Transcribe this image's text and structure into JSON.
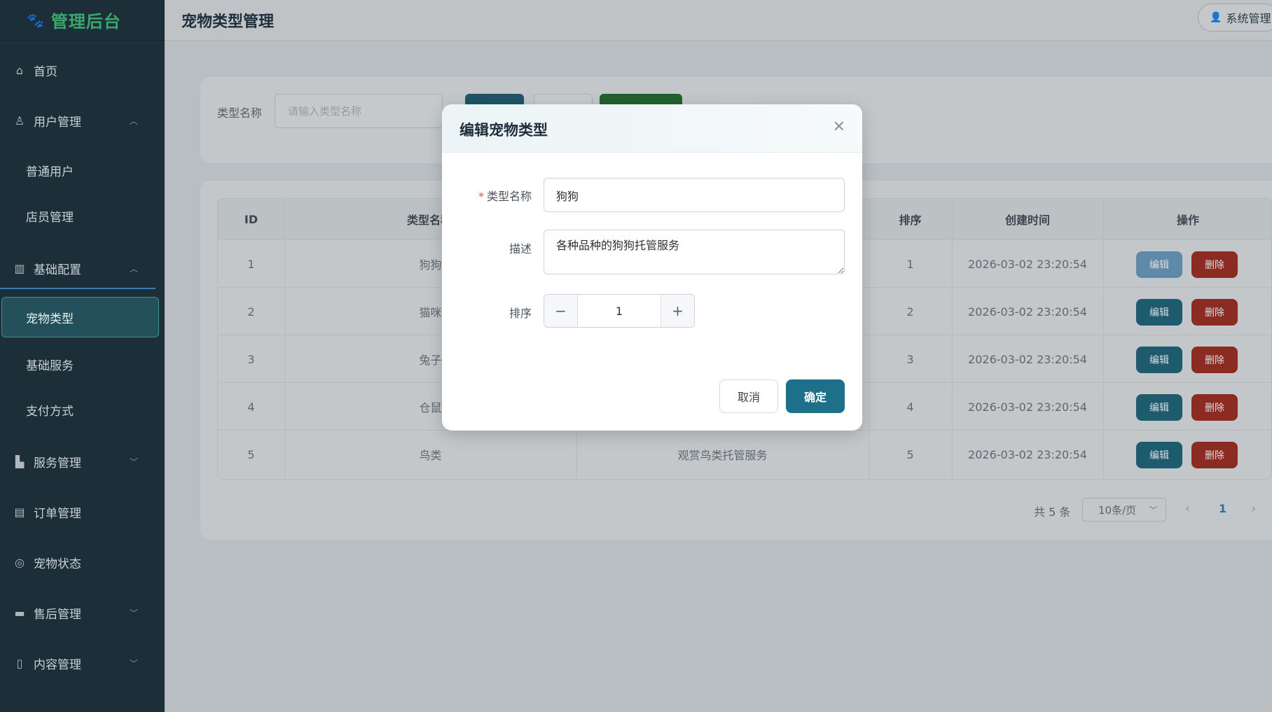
{
  "app": {
    "logo_text": "管理后台"
  },
  "header": {
    "page_title": "宠物类型管理",
    "user_label": "系统管理员"
  },
  "sidebar": {
    "home": "首页",
    "user_mgmt": "用户管理",
    "normal_users": "普通用户",
    "staff_mgmt": "店员管理",
    "base_config": "基础配置",
    "pet_types": "宠物类型",
    "base_services": "基础服务",
    "payment_methods": "支付方式",
    "service_mgmt": "服务管理",
    "order_mgmt": "订单管理",
    "pet_status": "宠物状态",
    "after_sales": "售后管理",
    "content_mgmt": "内容管理"
  },
  "search": {
    "label": "类型名称",
    "placeholder": "请输入类型名称"
  },
  "table": {
    "headers": {
      "id": "ID",
      "name": "类型名称",
      "sort": "排序",
      "created": "创建时间",
      "actions": "操作"
    },
    "edit_label": "编辑",
    "delete_label": "删除",
    "rows": [
      {
        "id": "1",
        "name": "狗狗",
        "desc": "",
        "sort": "1",
        "created": "2026-03-02 23:20:54"
      },
      {
        "id": "2",
        "name": "猫咪",
        "desc": "",
        "sort": "2",
        "created": "2026-03-02 23:20:54"
      },
      {
        "id": "3",
        "name": "兔子",
        "desc": "",
        "sort": "3",
        "created": "2026-03-02 23:20:54"
      },
      {
        "id": "4",
        "name": "仓鼠",
        "desc": "",
        "sort": "4",
        "created": "2026-03-02 23:20:54"
      },
      {
        "id": "5",
        "name": "鸟类",
        "desc": "观赏鸟类托管服务",
        "sort": "5",
        "created": "2026-03-02 23:20:54"
      }
    ]
  },
  "pagination": {
    "total_text": "共 5 条",
    "page_size": "10条/页",
    "current_page": "1"
  },
  "dialog": {
    "title": "编辑宠物类型",
    "name_label": "类型名称",
    "name_value": "狗狗",
    "desc_label": "描述",
    "desc_value": "各种品种的狗狗托管服务",
    "sort_label": "排序",
    "sort_value": "1",
    "cancel_label": "取消",
    "ok_label": "确定"
  },
  "colors": {
    "sidebar_bg": "#1c2e38",
    "primary": "#1d6f8a",
    "danger": "#8b2b22",
    "logo": "#3aa86a"
  }
}
